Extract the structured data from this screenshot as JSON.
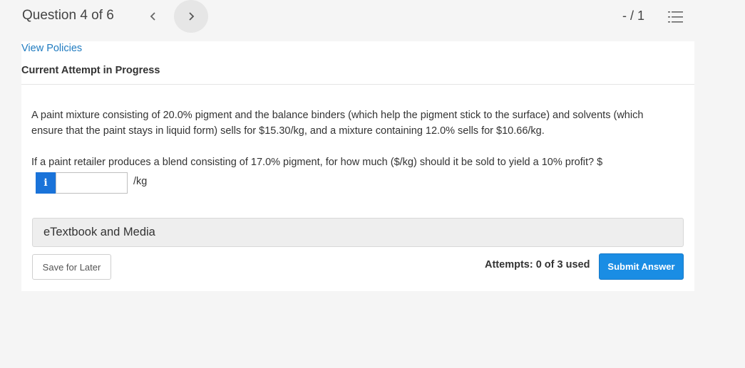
{
  "header": {
    "question_counter": "Question 4 of 6",
    "prev_icon": "chevron-left-icon",
    "next_icon": "chevron-right-icon",
    "score": "- / 1",
    "question_list_icon": "numbered-list-icon"
  },
  "card": {
    "policies_link": "View Policies",
    "attempt_status": "Current Attempt in Progress",
    "question_paragraph_1": "A paint mixture consisting of 20.0% pigment and the balance binders (which help the pigment stick to the surface) and solvents (which ensure that the paint stays in liquid form) sells for $15.30/kg, and a mixture containing 12.0% sells for $10.66/kg.",
    "question_paragraph_2": "If a paint retailer produces a blend consisting of 17.0% pigment, for how much ($/kg) should it be sold to yield a 10% profit? $",
    "answer": {
      "info_label": "i",
      "value": "",
      "unit": "/kg"
    },
    "etextbook_label": "eTextbook and Media",
    "save_label": "Save for Later",
    "attempts_text": "Attempts: 0 of 3 used",
    "submit_label": "Submit Answer"
  },
  "colors": {
    "page_background": "#f5f5f5",
    "link": "#1f7bc0",
    "primary_button": "#1a8de4",
    "info_button": "#1a73d9"
  }
}
